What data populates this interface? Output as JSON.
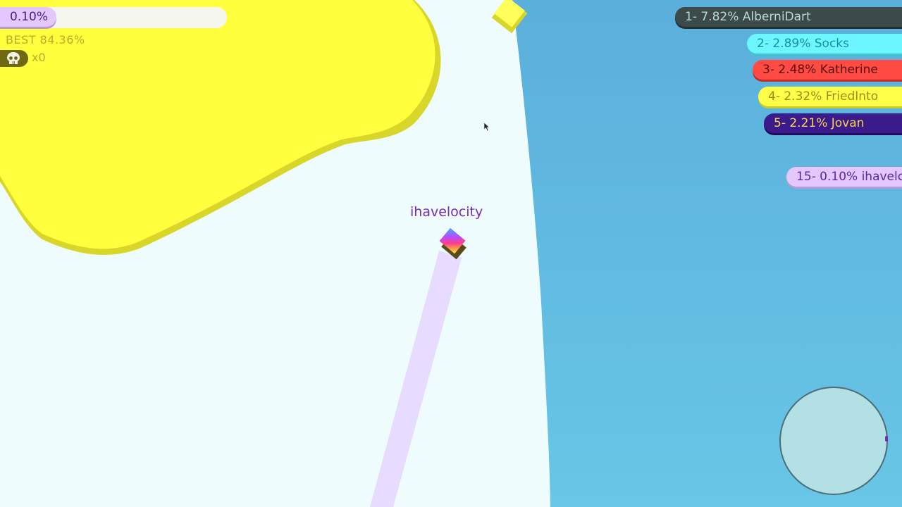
{
  "hud": {
    "percent_label": "0.10%",
    "best_label": "BEST 84.36%",
    "kills_label": "x0"
  },
  "player": {
    "name": "ihavelocity"
  },
  "leaderboard": [
    {
      "label": "1- 7.82% AlberniDart",
      "bg": "#3d4a4c",
      "shadow": "#263031",
      "fg": "#b7d9d8"
    },
    {
      "label": "2- 2.89% Socks",
      "bg": "#6cf6ff",
      "shadow": "#3cc5cf",
      "fg": "#198fa0"
    },
    {
      "label": "3- 2.48% Katherine",
      "bg": "#ff4b43",
      "shadow": "#c42a24",
      "fg": "#5a0d0a"
    },
    {
      "label": "4- 2.32% FriedInto",
      "bg": "#ffff47",
      "shadow": "#c9c92d",
      "fg": "#9a8f1c"
    },
    {
      "label": "5- 2.21% Jovan",
      "bg": "#3b1b8c",
      "shadow": "#220d5c",
      "fg": "#f6d44a"
    },
    {
      "label": "15- 0.10% ihavelc",
      "bg": "#e4c7ff",
      "shadow": "#b59ad6",
      "fg": "#5a2a9e"
    }
  ],
  "colors": {
    "yellow_territory": "#ffff3d",
    "blue_territory": "#60b7de",
    "background": "#eefcfd",
    "player_trail": "#e7dbff"
  }
}
